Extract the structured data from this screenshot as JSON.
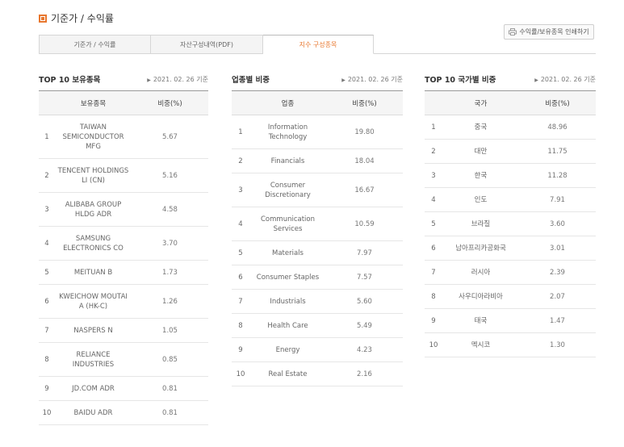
{
  "header": {
    "title": "기준가 / 수익률"
  },
  "tabs": [
    {
      "label": "기준가 / 수익률"
    },
    {
      "label": "자산구성내역(PDF)"
    },
    {
      "label": "지수 구성종목"
    }
  ],
  "print_button": {
    "label": "수익률/보유종목 인쇄하기",
    "icon": "printer-icon"
  },
  "accent_color": "#e8772e",
  "holdings": {
    "title": "TOP 10 보유종목",
    "date": "2021. 02. 26 기준",
    "columns": [
      "",
      "보유종목",
      "비중(%)"
    ],
    "rows": [
      {
        "no": "1",
        "name": "TAIWAN SEMICONDUCTOR MFG",
        "weight": "5.67"
      },
      {
        "no": "2",
        "name": "TENCENT HOLDINGS LI (CN)",
        "weight": "5.16"
      },
      {
        "no": "3",
        "name": "ALIBABA GROUP HLDG ADR",
        "weight": "4.58"
      },
      {
        "no": "4",
        "name": "SAMSUNG ELECTRONICS CO",
        "weight": "3.70"
      },
      {
        "no": "5",
        "name": "MEITUAN B",
        "weight": "1.73"
      },
      {
        "no": "6",
        "name": "KWEICHOW MOUTAI A (HK-C)",
        "weight": "1.26"
      },
      {
        "no": "7",
        "name": "NASPERS N",
        "weight": "1.05"
      },
      {
        "no": "8",
        "name": "RELIANCE INDUSTRIES",
        "weight": "0.85"
      },
      {
        "no": "9",
        "name": "JD.COM ADR",
        "weight": "0.81"
      },
      {
        "no": "10",
        "name": "BAIDU ADR",
        "weight": "0.81"
      }
    ]
  },
  "sectors": {
    "title": "업종별 비중",
    "date": "2021. 02. 26 기준",
    "columns": [
      "",
      "업종",
      "비중(%)"
    ],
    "rows": [
      {
        "no": "1",
        "name": "Information Technology",
        "weight": "19.80"
      },
      {
        "no": "2",
        "name": "Financials",
        "weight": "18.04"
      },
      {
        "no": "3",
        "name": "Consumer Discretionary",
        "weight": "16.67"
      },
      {
        "no": "4",
        "name": "Communication Services",
        "weight": "10.59"
      },
      {
        "no": "5",
        "name": "Materials",
        "weight": "7.97"
      },
      {
        "no": "6",
        "name": "Consumer Staples",
        "weight": "7.57"
      },
      {
        "no": "7",
        "name": "Industrials",
        "weight": "5.60"
      },
      {
        "no": "8",
        "name": "Health Care",
        "weight": "5.49"
      },
      {
        "no": "9",
        "name": "Energy",
        "weight": "4.23"
      },
      {
        "no": "10",
        "name": "Real Estate",
        "weight": "2.16"
      }
    ]
  },
  "countries": {
    "title": "TOP 10 국가별 비중",
    "date": "2021. 02. 26 기준",
    "columns": [
      "",
      "국가",
      "비중(%)"
    ],
    "rows": [
      {
        "no": "1",
        "name": "중국",
        "weight": "48.96"
      },
      {
        "no": "2",
        "name": "대만",
        "weight": "11.75"
      },
      {
        "no": "3",
        "name": "한국",
        "weight": "11.28"
      },
      {
        "no": "4",
        "name": "인도",
        "weight": "7.91"
      },
      {
        "no": "5",
        "name": "브라질",
        "weight": "3.60"
      },
      {
        "no": "6",
        "name": "남아프리카공화국",
        "weight": "3.01"
      },
      {
        "no": "7",
        "name": "러시아",
        "weight": "2.39"
      },
      {
        "no": "8",
        "name": "사우디아라비아",
        "weight": "2.07"
      },
      {
        "no": "9",
        "name": "태국",
        "weight": "1.47"
      },
      {
        "no": "10",
        "name": "멕시코",
        "weight": "1.30"
      }
    ]
  }
}
